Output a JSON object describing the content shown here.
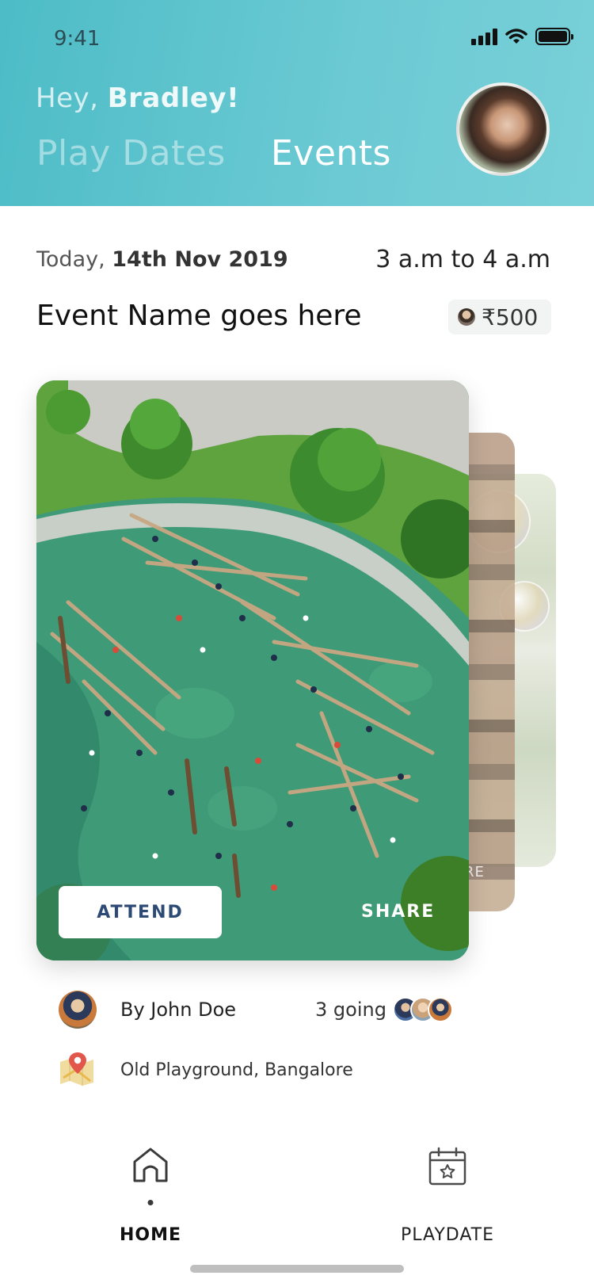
{
  "status_bar": {
    "time": "9:41"
  },
  "header": {
    "greeting_prefix": "Hey, ",
    "greeting_name": "Bradley!",
    "tabs": [
      {
        "label": "Play Dates",
        "active": false
      },
      {
        "label": "Events",
        "active": true
      }
    ]
  },
  "event": {
    "date_prefix": "Today, ",
    "date": "14th Nov 2019",
    "time_range": "3 a.m to 4 a.m",
    "name": "Event Name goes here",
    "price": "₹500"
  },
  "card": {
    "attend_label": "ATTEND",
    "share_label": "SHARE",
    "peek_share_label": "RE"
  },
  "host": {
    "label": "By John Doe",
    "going": "3 going"
  },
  "location": {
    "text": "Old Playground, Bangalore"
  },
  "bottom_nav": {
    "items": [
      {
        "label": "HOME",
        "icon": "home-icon",
        "active": true
      },
      {
        "label": "PLAYDATE",
        "icon": "calendar-star-icon",
        "active": false
      }
    ]
  },
  "colors": {
    "header_gradient_start": "#4dbcc6",
    "header_gradient_end": "#79d0d8",
    "attend_text": "#2c4a74"
  }
}
